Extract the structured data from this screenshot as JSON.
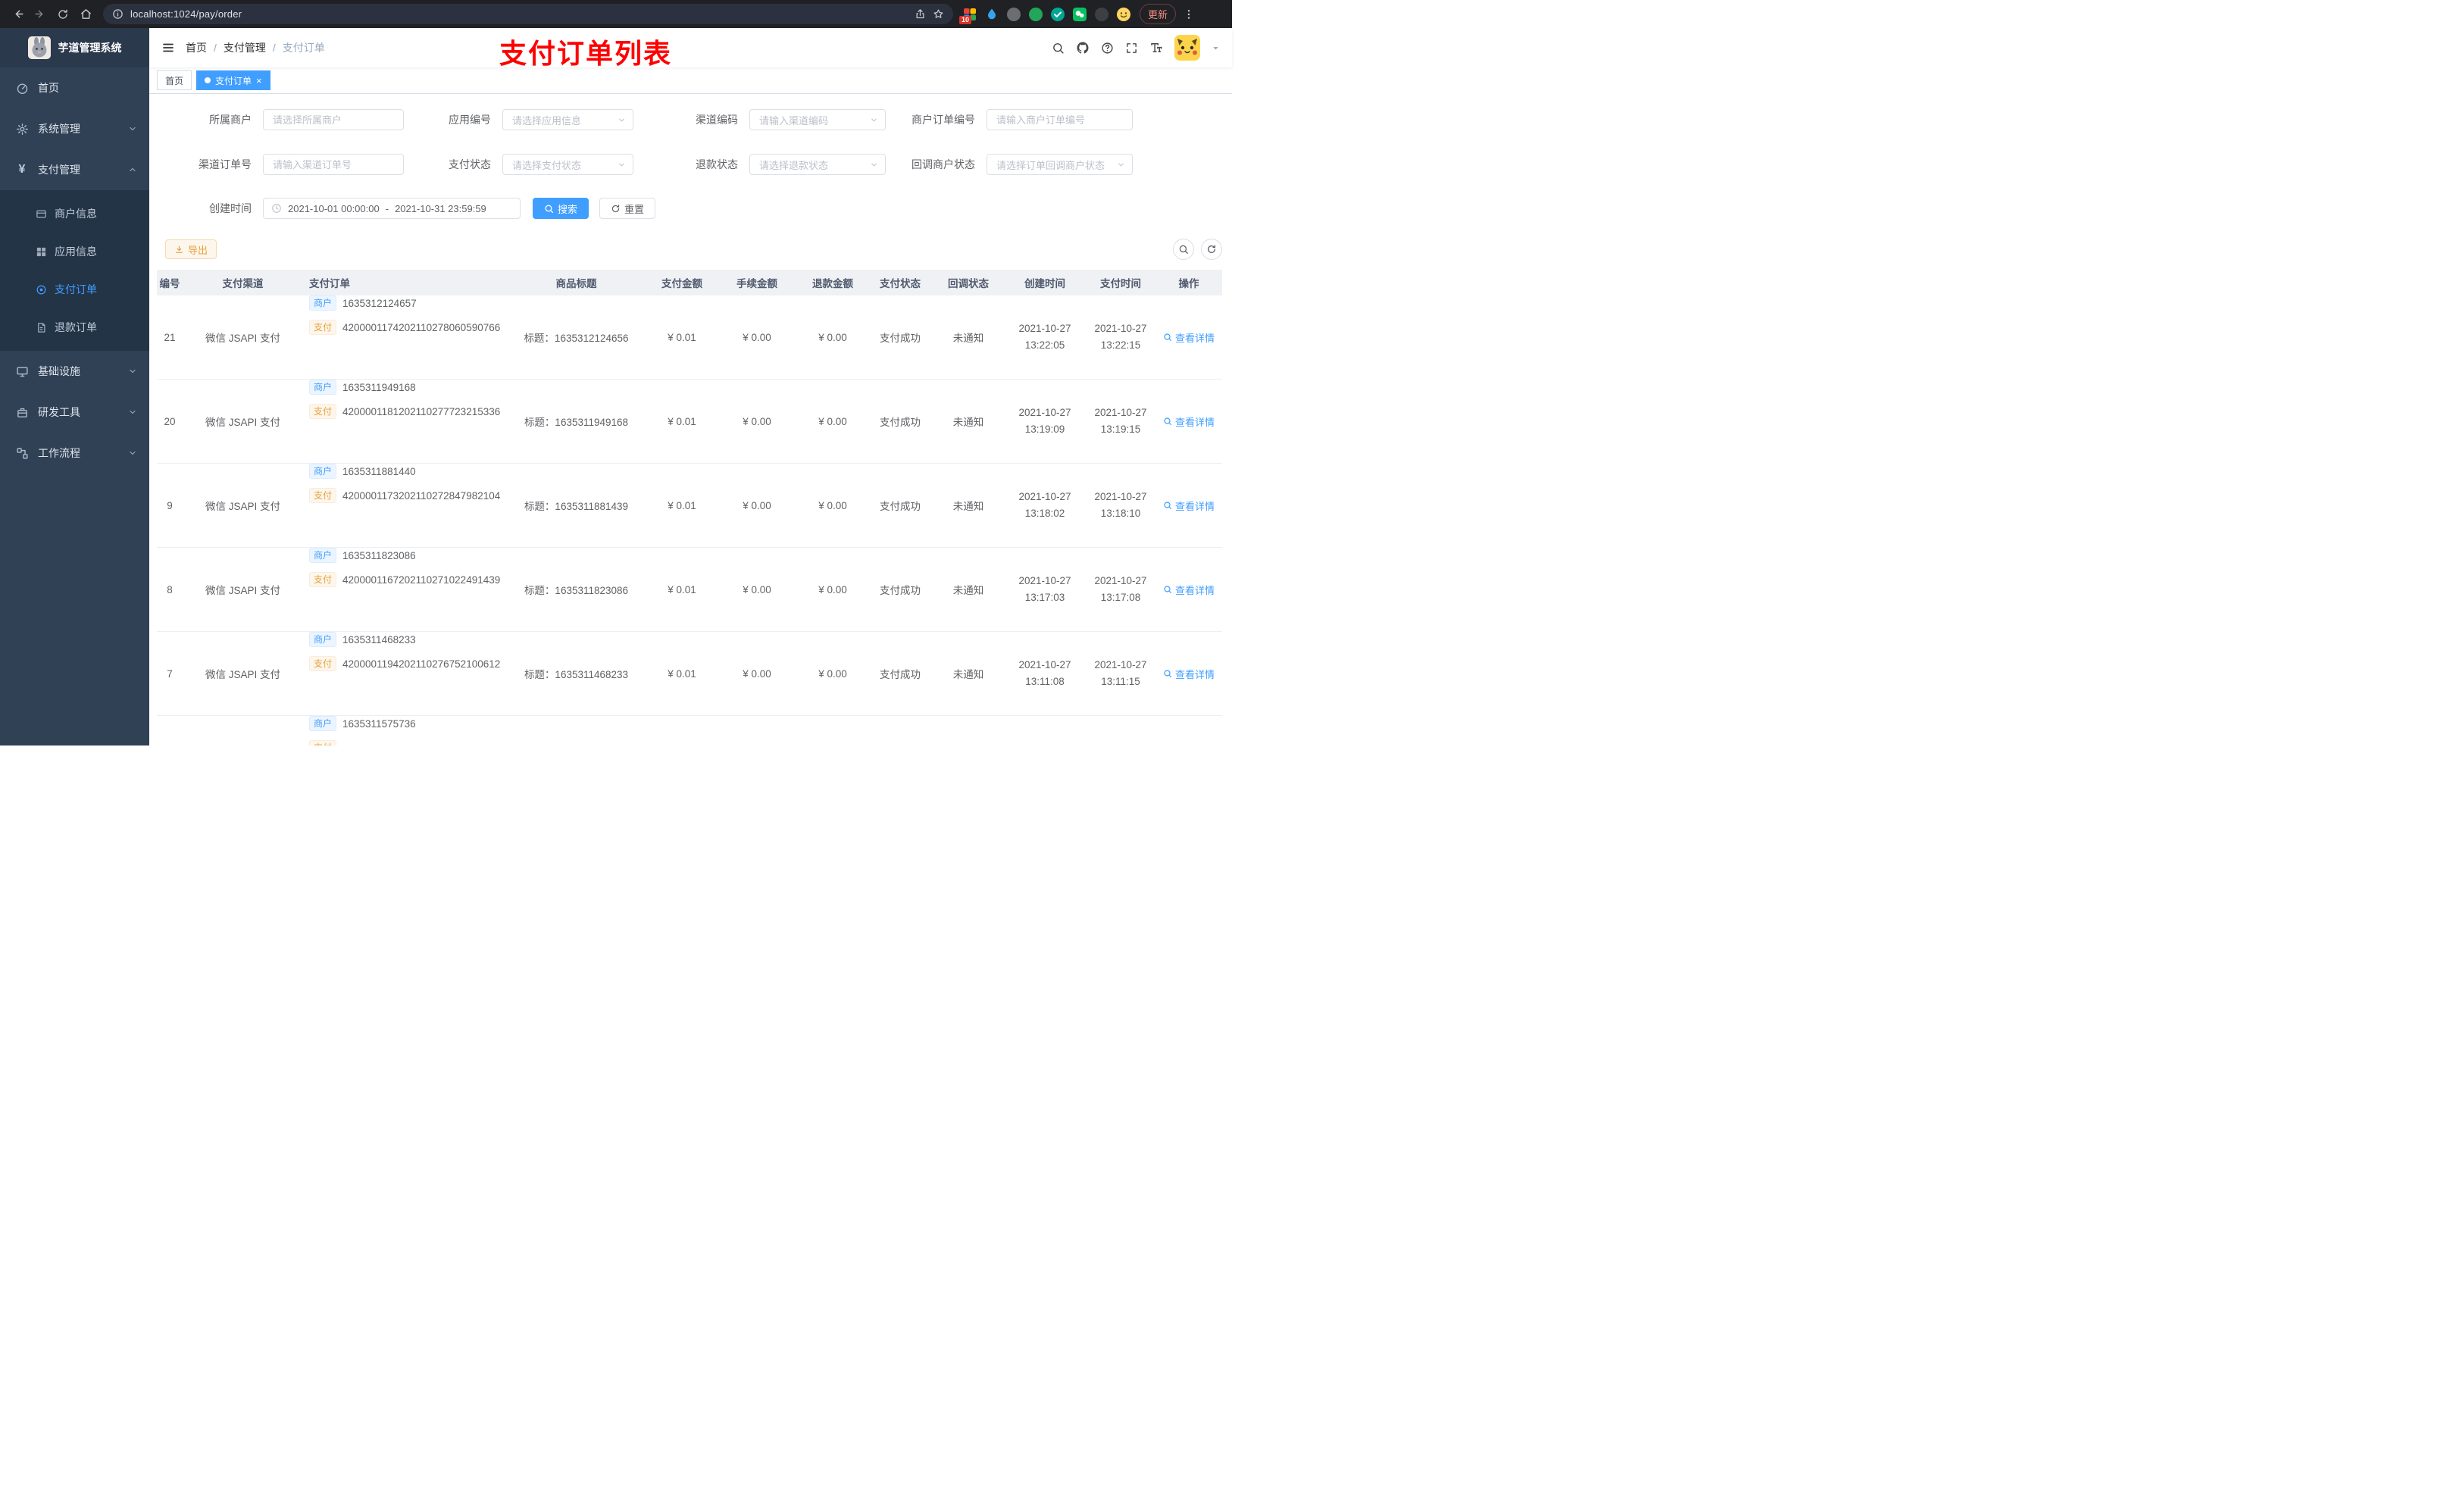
{
  "browser": {
    "url": "localhost:1024/pay/order",
    "update_label": "更新",
    "extension_badge": "10"
  },
  "sidebar": {
    "app_title": "芋道管理系统",
    "items": {
      "home": "首页",
      "system": "系统管理",
      "payment": "支付管理",
      "infra": "基础设施",
      "devtool": "研发工具",
      "workflow": "工作流程"
    },
    "payment_children": [
      "商户信息",
      "应用信息",
      "支付订单",
      "退款订单"
    ]
  },
  "topbar": {
    "breadcrumb": [
      "首页",
      "支付管理",
      "支付订单"
    ],
    "separator": "/",
    "annotation": "支付订单列表"
  },
  "tabs": {
    "home": "首页",
    "active": "支付订单"
  },
  "filters": {
    "merchant": {
      "label": "所属商户",
      "placeholder": "请选择所属商户"
    },
    "app": {
      "label": "应用编号",
      "placeholder": "请选择应用信息"
    },
    "channel_code": {
      "label": "渠道编码",
      "placeholder": "请输入渠道编码"
    },
    "merchant_order_no": {
      "label": "商户订单编号",
      "placeholder": "请输入商户订单编号"
    },
    "channel_order_no": {
      "label": "渠道订单号",
      "placeholder": "请输入渠道订单号"
    },
    "pay_status": {
      "label": "支付状态",
      "placeholder": "请选择支付状态"
    },
    "refund_status": {
      "label": "退款状态",
      "placeholder": "请选择退款状态"
    },
    "notify_status": {
      "label": "回调商户状态",
      "placeholder": "请选择订单回调商户状态"
    },
    "create_time": {
      "label": "创建时间",
      "start": "2021-10-01 00:00:00",
      "separator": "-",
      "end": "2021-10-31 23:59:59"
    },
    "search_label": "搜索",
    "reset_label": "重置"
  },
  "toolbar": {
    "export_label": "导出"
  },
  "table": {
    "columns": [
      "编号",
      "支付渠道",
      "支付订单",
      "商品标题",
      "支付金额",
      "手续金额",
      "退款金额",
      "支付状态",
      "回调状态",
      "创建时间",
      "支付时间",
      "操作"
    ],
    "tag_labels": {
      "merchant": "商户",
      "pay": "支付"
    },
    "rows": [
      {
        "id": "21",
        "channel": "微信 JSAPI 支付",
        "merchant_no": "1635312124657",
        "channel_no": "4200001174202110278060590766",
        "title": "标题：1635312124656",
        "pay_amount": "¥ 0.01",
        "fee_amount": "¥ 0.00",
        "refund_amount": "¥ 0.00",
        "pay_status": "支付成功",
        "notify_status": "未通知",
        "create_date": "2021-10-27",
        "create_time": "13:22:05",
        "pay_date": "2021-10-27",
        "pay_time": "13:22:15",
        "action": "查看详情"
      },
      {
        "id": "20",
        "channel": "微信 JSAPI 支付",
        "merchant_no": "1635311949168",
        "channel_no": "4200001181202110277723215336",
        "title": "标题：1635311949168",
        "pay_amount": "¥ 0.01",
        "fee_amount": "¥ 0.00",
        "refund_amount": "¥ 0.00",
        "pay_status": "支付成功",
        "notify_status": "未通知",
        "create_date": "2021-10-27",
        "create_time": "13:19:09",
        "pay_date": "2021-10-27",
        "pay_time": "13:19:15",
        "action": "查看详情"
      },
      {
        "id": "9",
        "channel": "微信 JSAPI 支付",
        "merchant_no": "1635311881440",
        "channel_no": "4200001173202110272847982104",
        "title": "标题：1635311881439",
        "pay_amount": "¥ 0.01",
        "fee_amount": "¥ 0.00",
        "refund_amount": "¥ 0.00",
        "pay_status": "支付成功",
        "notify_status": "未通知",
        "create_date": "2021-10-27",
        "create_time": "13:18:02",
        "pay_date": "2021-10-27",
        "pay_time": "13:18:10",
        "action": "查看详情"
      },
      {
        "id": "8",
        "channel": "微信 JSAPI 支付",
        "merchant_no": "1635311823086",
        "channel_no": "4200001167202110271022491439",
        "title": "标题：1635311823086",
        "pay_amount": "¥ 0.01",
        "fee_amount": "¥ 0.00",
        "refund_amount": "¥ 0.00",
        "pay_status": "支付成功",
        "notify_status": "未通知",
        "create_date": "2021-10-27",
        "create_time": "13:17:03",
        "pay_date": "2021-10-27",
        "pay_time": "13:17:08",
        "action": "查看详情"
      },
      {
        "id": "7",
        "channel": "微信 JSAPI 支付",
        "merchant_no": "1635311468233",
        "channel_no": "4200001194202110276752100612",
        "title": "标题：1635311468233",
        "pay_amount": "¥ 0.01",
        "fee_amount": "¥ 0.00",
        "refund_amount": "¥ 0.00",
        "pay_status": "支付成功",
        "notify_status": "未通知",
        "create_date": "2021-10-27",
        "create_time": "13:11:08",
        "pay_date": "2021-10-27",
        "pay_time": "13:11:15",
        "action": "查看详情"
      },
      {
        "id": "",
        "channel": "",
        "merchant_no": "1635311575736",
        "channel_no": "",
        "title": "",
        "pay_amount": "",
        "fee_amount": "",
        "refund_amount": "",
        "pay_status": "",
        "notify_status": "",
        "create_date": "",
        "create_time": "",
        "pay_date": "",
        "pay_time": "",
        "action": ""
      }
    ]
  },
  "colors": {
    "accent": "#409eff",
    "warning": "#e6a23c",
    "annotation_red": "#ff0000",
    "sidebar_bg": "#304156"
  }
}
